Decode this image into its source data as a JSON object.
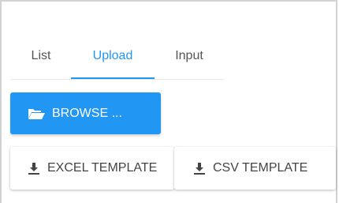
{
  "tabs": {
    "items": [
      {
        "label": "List"
      },
      {
        "label": "Upload"
      },
      {
        "label": "Input"
      }
    ],
    "active": "Upload"
  },
  "actions": {
    "browse_label": "BROWSE ...",
    "excel_template_label": "EXCEL TEMPLATE",
    "csv_template_label": "CSV TEMPLATE"
  },
  "icons": {
    "browse": "folder-open-icon",
    "excel": "download-icon",
    "csv": "download-icon"
  },
  "colors": {
    "accent": "#2196f3",
    "text": "#555555"
  }
}
